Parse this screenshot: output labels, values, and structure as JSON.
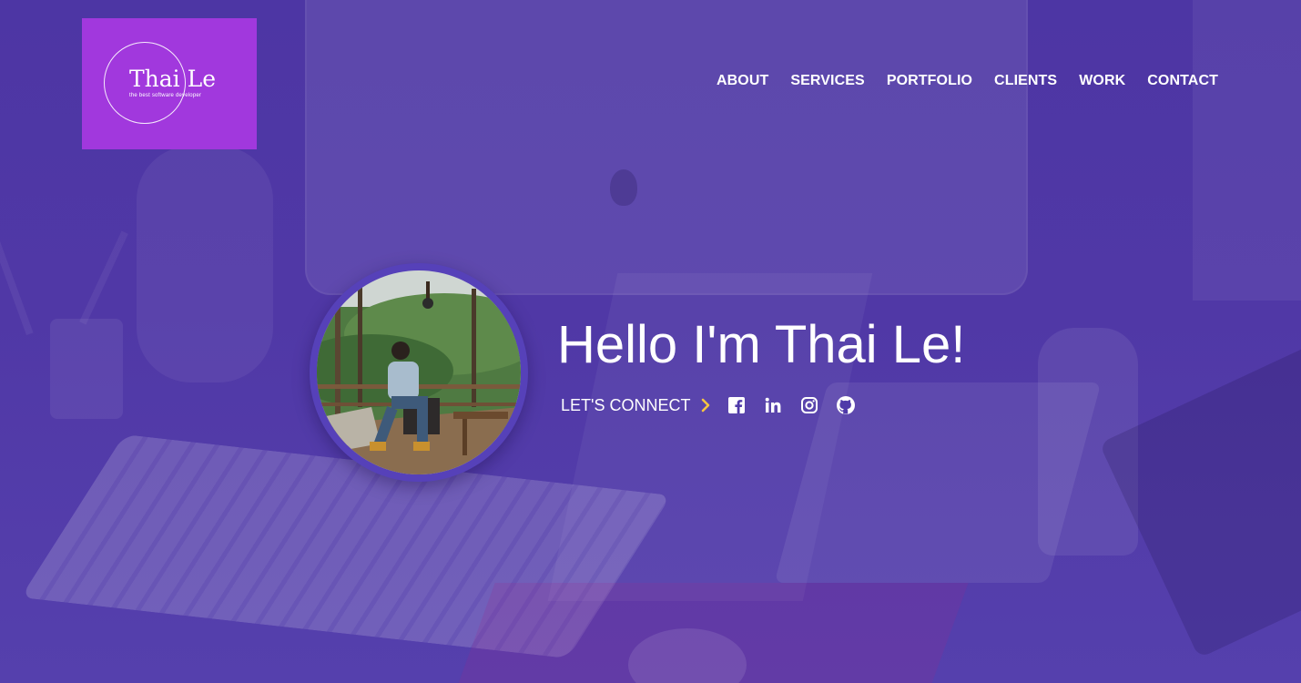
{
  "logo": {
    "title": "Thai Le",
    "subtitle": "the best software developer"
  },
  "nav": {
    "items": [
      {
        "label": "ABOUT"
      },
      {
        "label": "SERVICES"
      },
      {
        "label": "PORTFOLIO"
      },
      {
        "label": "CLIENTS"
      },
      {
        "label": "WORK"
      },
      {
        "label": "CONTACT"
      }
    ]
  },
  "hero": {
    "heading": "Hello I'm Thai Le!",
    "connect_label": "LET'S CONNECT",
    "social_icons": [
      "facebook-icon",
      "linkedin-icon",
      "instagram-icon",
      "github-icon"
    ]
  },
  "colors": {
    "background": "#4d36a4",
    "logo_bg": "#a138dd",
    "accent": "#f5c542",
    "text": "#ffffff"
  }
}
